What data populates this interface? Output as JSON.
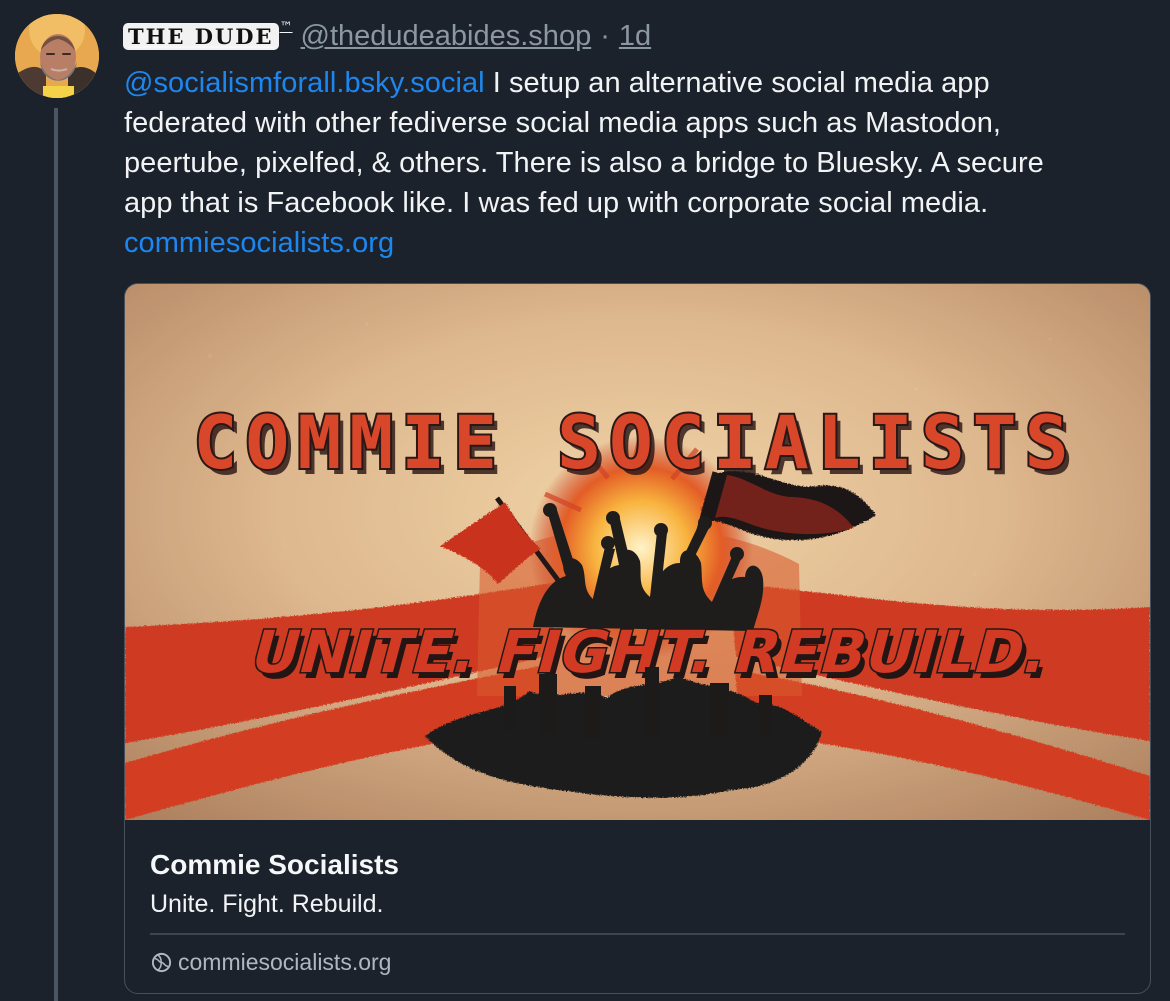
{
  "post": {
    "author": {
      "display_name": "THE DUDE",
      "display_name_mark": "™",
      "handle": "@thedudeabides.shop",
      "separator": "·",
      "time_ago": "1d",
      "avatar_icon": "bearded-man-avatar"
    },
    "text": {
      "mention": "@socialismforall.bsky.social",
      "line1_rest": " I setup an alternative social media app",
      "line2": "federated with other fediverse social media apps such as Mastodon,",
      "line3": "peertube, pixelfed, & others. There is also a bridge to Bluesky. A secure",
      "line4": "app that is Facebook like. I was fed up with corporate social media.",
      "link": "commiesocialists.org"
    },
    "link_card": {
      "image_text": {
        "headline": "COMMIE SOCIALISTS",
        "slogan": "UNITE. FIGHT. REBUILD."
      },
      "title": "Commie Socialists",
      "description": "Unite. Fight. Rebuild.",
      "domain": "commiesocialists.org",
      "domain_icon": "globe-icon"
    }
  },
  "colors": {
    "background": "#1b222b",
    "text": "#f1f3f5",
    "muted": "#8b97a3",
    "link": "#1d87ef",
    "thread_line": "#4b5663",
    "card_border": "#45505c",
    "poster_red": "#cf3a22",
    "poster_dark": "#171515",
    "poster_cream": "#e5c9a4"
  }
}
